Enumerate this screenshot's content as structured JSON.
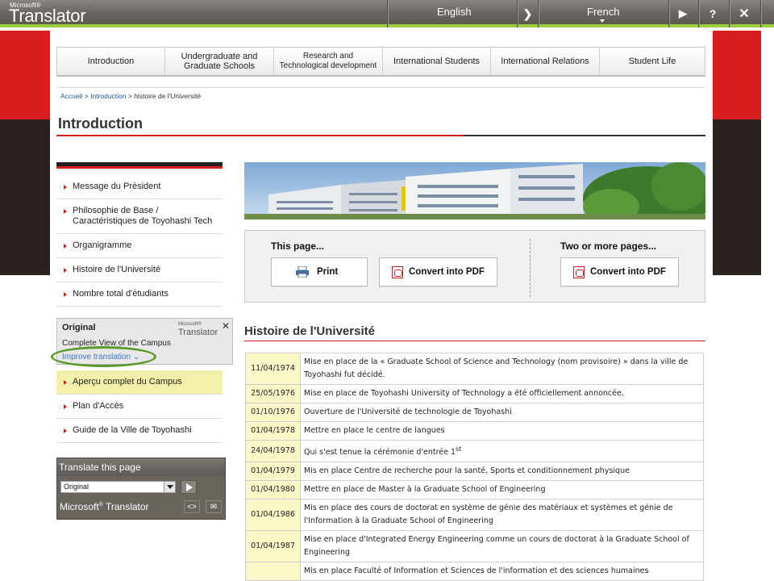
{
  "translator": {
    "brand_small": "Microsoft®",
    "brand": "Translator",
    "from_lang": "English",
    "to_lang": "French",
    "play_glyph": "▶",
    "help_glyph": "?",
    "close_glyph": "✕",
    "swap_glyph": "❯",
    "accent_color": "#9acd3a"
  },
  "nav": {
    "items": [
      "Introduction",
      "Undergraduate and\nGraduate Schools",
      "Research and\nTechnological development",
      "International Students",
      "International Relations",
      "Student Life"
    ]
  },
  "breadcrumb": {
    "home": "Accueil",
    "sep1": " > ",
    "section": "Introduction",
    "sep2": " > ",
    "current": "histoire de l'Université"
  },
  "page_title": "Introduction",
  "sidebar": {
    "items": [
      "Message du Président",
      "Philosophie de Base / Caractéristiques de Toyohashi Tech",
      "Organigramme",
      "Histoire de l'Université",
      "Nombre total d'étudiants"
    ],
    "items2": [
      "Aperçu complet du Campus",
      "Plan d'Accès",
      "Guide de la Ville de Toyohashi"
    ]
  },
  "original_popup": {
    "title": "Original",
    "brand_small": "Microsoft®",
    "brand": "Translator",
    "close": "✕",
    "original_text": "Complete View of the Campus",
    "improve": "Improve translation ⌄"
  },
  "translate_widget": {
    "title": "Translate this page",
    "selected": "Original",
    "footer_brand": "Microsoft",
    "footer_reg": "®",
    "footer_product": " Translator",
    "embed_glyph": "<>",
    "mail_glyph": "✉"
  },
  "print_box": {
    "this_page": "This page...",
    "more_pages": "Two or more pages...",
    "print": "Print",
    "pdf1": "Convert into PDF",
    "pdf2": "Convert into PDF"
  },
  "history": {
    "title": "Histoire de l'Université",
    "rows": [
      {
        "date": "11/04/1974",
        "event": "Mise en place de la « Graduate School of Science and Technology (nom provisoire) » dans la ville de Toyohashi fut décidé."
      },
      {
        "date": "25/05/1976",
        "event": "Mise en place de Toyohashi University of Technology a été officiellement annoncée."
      },
      {
        "date": "01/10/1976",
        "event": "Ouverture de l'Université de technologie de Toyohashi"
      },
      {
        "date": "01/04/1978",
        "event": "Mettre en place le centre de langues"
      },
      {
        "date": "24/04/1978",
        "event": "Qui s'est tenue la cérémonie d'entrée 1",
        "sup": "st"
      },
      {
        "date": "01/04/1979",
        "event": "Mis en place Centre de recherche pour la santé, Sports et conditionnement physique"
      },
      {
        "date": "01/04/1980",
        "event": "Mettre en place de Master à la Graduate School of Engineering"
      },
      {
        "date": "01/04/1986",
        "event": "Mis en place des cours de doctorat en système de génie des matériaux et systèmes et génie de l'Information à la Graduate School of Engineering"
      },
      {
        "date": "01/04/1987",
        "event": "Mise en place d'Integrated Energy Engineering comme un cours de doctorat à la Graduate School of Engineering"
      },
      {
        "date": "",
        "event": "Mis en place Faculté of Information et Sciences de l'information et des sciences humaines"
      }
    ]
  }
}
